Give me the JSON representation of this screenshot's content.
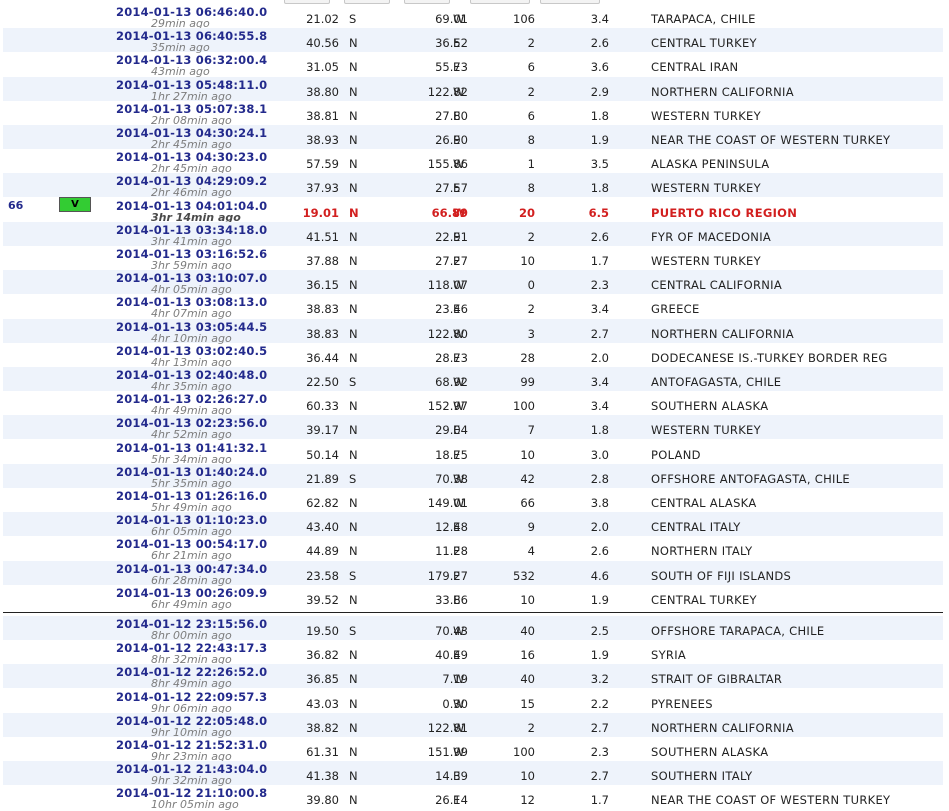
{
  "highlight": {
    "number": "66",
    "badge": "V"
  },
  "rows": [
    {
      "dt": "2014-01-13  06:46:40.0",
      "ago": "29min ago",
      "lat": "21.02",
      "ns": "S",
      "lon": "69.01",
      "ew": "W",
      "depth": "106",
      "mag": "3.4",
      "region": "TARAPACA, CHILE"
    },
    {
      "dt": "2014-01-13  06:40:55.8",
      "ago": "35min ago",
      "lat": "40.56",
      "ns": "N",
      "lon": "36.52",
      "ew": "E",
      "depth": "2",
      "mag": "2.6",
      "region": "CENTRAL TURKEY"
    },
    {
      "dt": "2014-01-13  06:32:00.4",
      "ago": "43min ago",
      "lat": "31.05",
      "ns": "N",
      "lon": "55.73",
      "ew": "E",
      "depth": "6",
      "mag": "3.6",
      "region": "CENTRAL IRAN"
    },
    {
      "dt": "2014-01-13  05:48:11.0",
      "ago": "1hr 27min ago",
      "lat": "38.80",
      "ns": "N",
      "lon": "122.82",
      "ew": "W",
      "depth": "2",
      "mag": "2.9",
      "region": "NORTHERN CALIFORNIA"
    },
    {
      "dt": "2014-01-13  05:07:38.1",
      "ago": "2hr 08min ago",
      "lat": "38.81",
      "ns": "N",
      "lon": "27.80",
      "ew": "E",
      "depth": "6",
      "mag": "1.8",
      "region": "WESTERN TURKEY"
    },
    {
      "dt": "2014-01-13  04:30:24.1",
      "ago": "2hr 45min ago",
      "lat": "38.93",
      "ns": "N",
      "lon": "26.90",
      "ew": "E",
      "depth": "8",
      "mag": "1.9",
      "region": "NEAR THE COAST OF WESTERN TURKEY"
    },
    {
      "dt": "2014-01-13  04:30:23.0",
      "ago": "2hr 45min ago",
      "lat": "57.59",
      "ns": "N",
      "lon": "155.86",
      "ew": "W",
      "depth": "1",
      "mag": "3.5",
      "region": "ALASKA PENINSULA"
    },
    {
      "dt": "2014-01-13  04:29:09.2",
      "ago": "2hr 46min ago",
      "lat": "37.93",
      "ns": "N",
      "lon": "27.57",
      "ew": "E",
      "depth": "8",
      "mag": "1.8",
      "region": "WESTERN TURKEY"
    },
    {
      "dt": "2014-01-13  04:01:04.0",
      "ago": "3hr 14min ago",
      "lat": "19.01",
      "ns": "N",
      "lon": "66.89",
      "ew": "W",
      "depth": "20",
      "mag": "6.5",
      "region": "PUERTO RICO REGION",
      "highlight": true
    },
    {
      "dt": "2014-01-13  03:34:18.0",
      "ago": "3hr 41min ago",
      "lat": "41.51",
      "ns": "N",
      "lon": "22.91",
      "ew": "E",
      "depth": "2",
      "mag": "2.6",
      "region": "FYR OF MACEDONIA"
    },
    {
      "dt": "2014-01-13  03:16:52.6",
      "ago": "3hr 59min ago",
      "lat": "37.88",
      "ns": "N",
      "lon": "27.27",
      "ew": "E",
      "depth": "10",
      "mag": "1.7",
      "region": "WESTERN TURKEY"
    },
    {
      "dt": "2014-01-13  03:10:07.0",
      "ago": "4hr 05min ago",
      "lat": "36.15",
      "ns": "N",
      "lon": "118.07",
      "ew": "W",
      "depth": "0",
      "mag": "2.3",
      "region": "CENTRAL CALIFORNIA"
    },
    {
      "dt": "2014-01-13  03:08:13.0",
      "ago": "4hr 07min ago",
      "lat": "38.83",
      "ns": "N",
      "lon": "23.46",
      "ew": "E",
      "depth": "2",
      "mag": "3.4",
      "region": "GREECE"
    },
    {
      "dt": "2014-01-13  03:05:44.5",
      "ago": "4hr 10min ago",
      "lat": "38.83",
      "ns": "N",
      "lon": "122.80",
      "ew": "W",
      "depth": "3",
      "mag": "2.7",
      "region": "NORTHERN CALIFORNIA"
    },
    {
      "dt": "2014-01-13  03:02:40.5",
      "ago": "4hr 13min ago",
      "lat": "36.44",
      "ns": "N",
      "lon": "28.73",
      "ew": "E",
      "depth": "28",
      "mag": "2.0",
      "region": "DODECANESE IS.-TURKEY BORDER REG"
    },
    {
      "dt": "2014-01-13  02:40:48.0",
      "ago": "4hr 35min ago",
      "lat": "22.50",
      "ns": "S",
      "lon": "68.92",
      "ew": "W",
      "depth": "99",
      "mag": "3.4",
      "region": "ANTOFAGASTA, CHILE"
    },
    {
      "dt": "2014-01-13  02:26:27.0",
      "ago": "4hr 49min ago",
      "lat": "60.33",
      "ns": "N",
      "lon": "152.97",
      "ew": "W",
      "depth": "100",
      "mag": "3.4",
      "region": "SOUTHERN ALASKA"
    },
    {
      "dt": "2014-01-13  02:23:56.0",
      "ago": "4hr 52min ago",
      "lat": "39.17",
      "ns": "N",
      "lon": "29.04",
      "ew": "E",
      "depth": "7",
      "mag": "1.8",
      "region": "WESTERN TURKEY"
    },
    {
      "dt": "2014-01-13  01:41:32.1",
      "ago": "5hr 34min ago",
      "lat": "50.14",
      "ns": "N",
      "lon": "18.75",
      "ew": "E",
      "depth": "10",
      "mag": "3.0",
      "region": "POLAND"
    },
    {
      "dt": "2014-01-13  01:40:24.0",
      "ago": "5hr 35min ago",
      "lat": "21.89",
      "ns": "S",
      "lon": "70.38",
      "ew": "W",
      "depth": "42",
      "mag": "2.8",
      "region": "OFFSHORE ANTOFAGASTA, CHILE"
    },
    {
      "dt": "2014-01-13  01:26:16.0",
      "ago": "5hr 49min ago",
      "lat": "62.82",
      "ns": "N",
      "lon": "149.01",
      "ew": "W",
      "depth": "66",
      "mag": "3.8",
      "region": "CENTRAL ALASKA"
    },
    {
      "dt": "2014-01-13  01:10:23.0",
      "ago": "6hr 05min ago",
      "lat": "43.40",
      "ns": "N",
      "lon": "12.48",
      "ew": "E",
      "depth": "9",
      "mag": "2.0",
      "region": "CENTRAL ITALY"
    },
    {
      "dt": "2014-01-13  00:54:17.0",
      "ago": "6hr 21min ago",
      "lat": "44.89",
      "ns": "N",
      "lon": "11.28",
      "ew": "E",
      "depth": "4",
      "mag": "2.6",
      "region": "NORTHERN ITALY"
    },
    {
      "dt": "2014-01-13  00:47:34.0",
      "ago": "6hr 28min ago",
      "lat": "23.58",
      "ns": "S",
      "lon": "179.27",
      "ew": "E",
      "depth": "532",
      "mag": "4.6",
      "region": "SOUTH OF FIJI ISLANDS"
    },
    {
      "dt": "2014-01-13  00:26:09.9",
      "ago": "6hr 49min ago",
      "lat": "39.52",
      "ns": "N",
      "lon": "33.86",
      "ew": "E",
      "depth": "10",
      "mag": "1.9",
      "region": "CENTRAL TURKEY"
    },
    {
      "dt": "2014-01-12  23:15:56.0",
      "ago": "8hr 00min ago",
      "lat": "19.50",
      "ns": "S",
      "lon": "70.43",
      "ew": "W",
      "depth": "40",
      "mag": "2.5",
      "region": "OFFSHORE TARAPACA, CHILE"
    },
    {
      "dt": "2014-01-12  22:43:17.3",
      "ago": "8hr 32min ago",
      "lat": "36.82",
      "ns": "N",
      "lon": "40.49",
      "ew": "E",
      "depth": "16",
      "mag": "1.9",
      "region": "SYRIA"
    },
    {
      "dt": "2014-01-12  22:26:52.0",
      "ago": "8hr 49min ago",
      "lat": "36.85",
      "ns": "N",
      "lon": "7.19",
      "ew": "W",
      "depth": "40",
      "mag": "3.2",
      "region": "STRAIT OF GIBRALTAR"
    },
    {
      "dt": "2014-01-12  22:09:57.3",
      "ago": "9hr 06min ago",
      "lat": "43.03",
      "ns": "N",
      "lon": "0.30",
      "ew": "W",
      "depth": "15",
      "mag": "2.2",
      "region": "PYRENEES"
    },
    {
      "dt": "2014-01-12  22:05:48.0",
      "ago": "9hr 10min ago",
      "lat": "38.82",
      "ns": "N",
      "lon": "122.81",
      "ew": "W",
      "depth": "2",
      "mag": "2.7",
      "region": "NORTHERN CALIFORNIA"
    },
    {
      "dt": "2014-01-12  21:52:31.0",
      "ago": "9hr 23min ago",
      "lat": "61.31",
      "ns": "N",
      "lon": "151.99",
      "ew": "W",
      "depth": "100",
      "mag": "2.3",
      "region": "SOUTHERN ALASKA"
    },
    {
      "dt": "2014-01-12  21:43:04.0",
      "ago": "9hr 32min ago",
      "lat": "41.38",
      "ns": "N",
      "lon": "14.39",
      "ew": "E",
      "depth": "10",
      "mag": "2.7",
      "region": "SOUTHERN ITALY"
    },
    {
      "dt": "2014-01-12  21:10:00.8",
      "ago": "10hr 05min ago",
      "lat": "39.80",
      "ns": "N",
      "lon": "26.14",
      "ew": "E",
      "depth": "12",
      "mag": "1.7",
      "region": "NEAR THE COAST OF WESTERN TURKEY"
    }
  ]
}
